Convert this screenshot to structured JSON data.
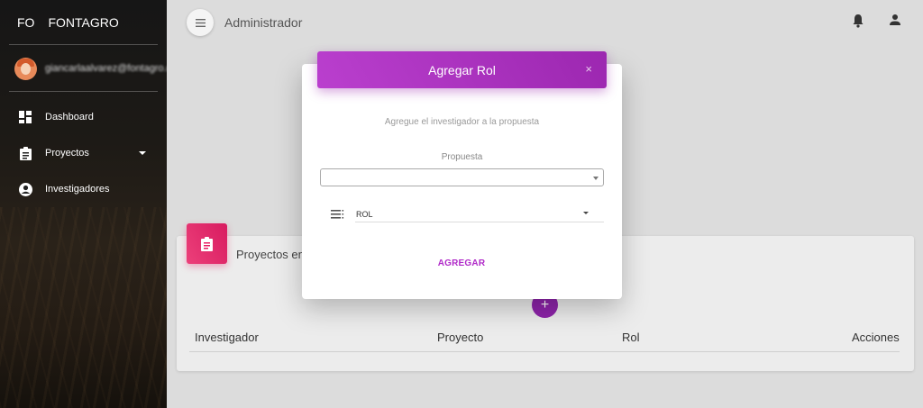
{
  "sidebar": {
    "brand_mini": "FO",
    "brand_name": "FONTAGRO",
    "user_email": "giancarlaalvarez@fontagro.org",
    "items": [
      {
        "label": "Dashboard",
        "icon": "dashboard-icon"
      },
      {
        "label": "Proyectos",
        "icon": "clipboard-icon"
      },
      {
        "label": "Investigadores",
        "icon": "account-circle-icon"
      }
    ]
  },
  "header": {
    "title": "Administrador",
    "icons": [
      "menu-icon",
      "bell-icon",
      "person-icon"
    ]
  },
  "card": {
    "title": "Proyectos en",
    "table_headers": [
      "Investigador",
      "Proyecto",
      "Rol",
      "Acciones"
    ],
    "fab_label": "+"
  },
  "modal": {
    "title": "Agregar Rol",
    "close_label": "×",
    "subtitle": "Agregue el investigador a la propuesta",
    "propuesta_label": "Propuesta",
    "propuesta_value": "",
    "rol_value": "ROL",
    "submit_label": "AGREGAR"
  },
  "colors": {
    "accent": "#9c27b0",
    "card_icon": "#e91e63",
    "fab": "#8e24aa"
  }
}
